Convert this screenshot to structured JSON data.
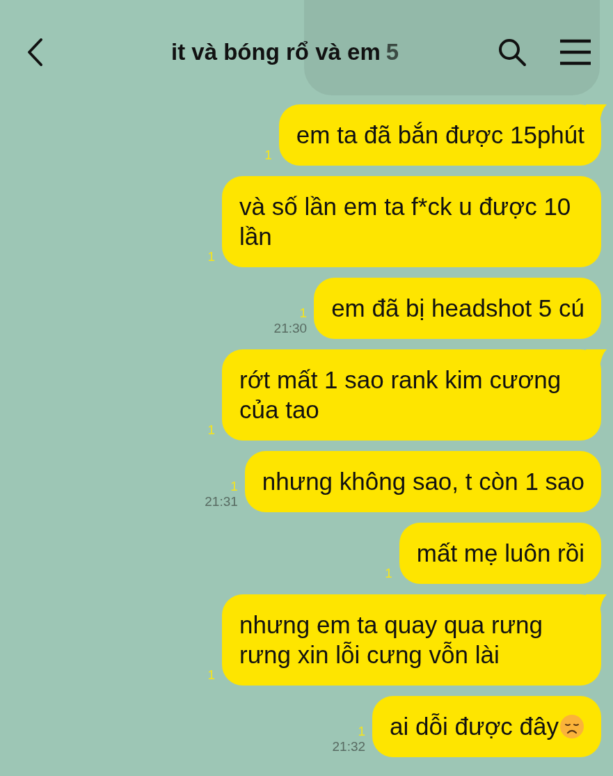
{
  "header": {
    "title": "it và bóng rổ và em",
    "member_count": "5"
  },
  "messages": [
    {
      "text": "em ta đã bắn được 15phút",
      "read": "1",
      "tail": true
    },
    {
      "text": "và số lần em ta f*ck u được 10 lần",
      "read": "1",
      "tail": false
    },
    {
      "text": "em đã bị headshot 5 cú",
      "read": "1",
      "time": "21:30",
      "tail": false
    },
    {
      "text": "rớt mất 1 sao rank kim cương của tao",
      "read": "1",
      "tail": true
    },
    {
      "text": "nhưng không sao, t còn 1 sao",
      "read": "1",
      "time": "21:31",
      "tail": false
    },
    {
      "text": "mất mẹ luôn rồi",
      "read": "1",
      "tail": false
    },
    {
      "text": "nhưng em ta quay qua rưng rưng xin lỗi cưng vỗn lài",
      "read": "1",
      "tail": true
    },
    {
      "text": "ai dỗi được đây",
      "kind": "with_emoji",
      "read": "1",
      "time": "21:32",
      "tail": false
    }
  ]
}
